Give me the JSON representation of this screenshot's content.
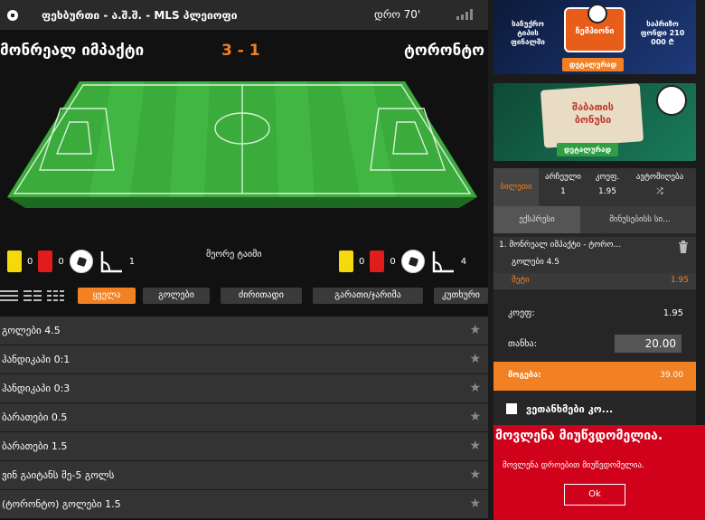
{
  "header": {
    "title": "ფეხბურთი - ა.შ.შ. - MLS პლეიოფი",
    "time": "დრო 70'"
  },
  "match": {
    "home": "მონრეალ იმპაქტი",
    "score": "3 - 1",
    "away": "ტორონტო",
    "extra_time_label": "მეორე ტაიმი",
    "home_stats": {
      "yellow": "0",
      "red": "0",
      "corners": "1"
    },
    "away_stats": {
      "yellow": "0",
      "red": "0",
      "corners": "4"
    }
  },
  "filters": {
    "buttons": [
      "ყველა",
      "გოლები",
      "ძირითადი",
      "გარათი/ჯარიმა",
      "კუთხური"
    ]
  },
  "markets": [
    "გოლები 4.5",
    "ჰანდიკაპი 0:1",
    "ჰანდიკაპი 0:3",
    "ბარათები 0.5",
    "ბარათები 1.5",
    "ვინ გაიტანს მე-5 გოლს",
    "(ტორონტო) გოლები 1.5"
  ],
  "banners": {
    "b1_left": "საჩუქრო ტიპის ფინალში",
    "b1_center": "ჩემპიონი",
    "b1_right": "საპრიზო ფონდი 210 000 ₾",
    "b1_cta": "დეტალურად",
    "b2_text": "შაბათის ბონუსი",
    "b2_cta": "დეტალურად"
  },
  "slip": {
    "tab_active": "ბილეთი",
    "col1_head": "არჩეული",
    "col1_val": "1",
    "col2_head": "კოეფ.",
    "col2_val": "1.95",
    "col3_head": "ავტომიღება",
    "subtab1": "ექსპრესი",
    "subtab2": "მინუსებისს სი...",
    "bet_name": "1. მონრეალ იმპაქტი - ტორო...",
    "bet_market": "გოლები 4.5",
    "bet_pick": "მეტი",
    "bet_odd": "1.95",
    "coef_label": "კოეფ:",
    "coef_value": "1.95",
    "stake_label": "თანხა:",
    "stake_value": "20.00",
    "win_label": "მოგება:",
    "win_value": "39.00",
    "agree_label": "ვეთანხმები კო..."
  },
  "error": {
    "title": "მოვლენა მიუწვდომელია.",
    "message": "მოვლენა დროებით მიუწვდომელია.",
    "ok": "Ok"
  },
  "colors": {
    "accent": "#f28123",
    "error": "#d0021b",
    "pitch": "#3bab3b"
  }
}
